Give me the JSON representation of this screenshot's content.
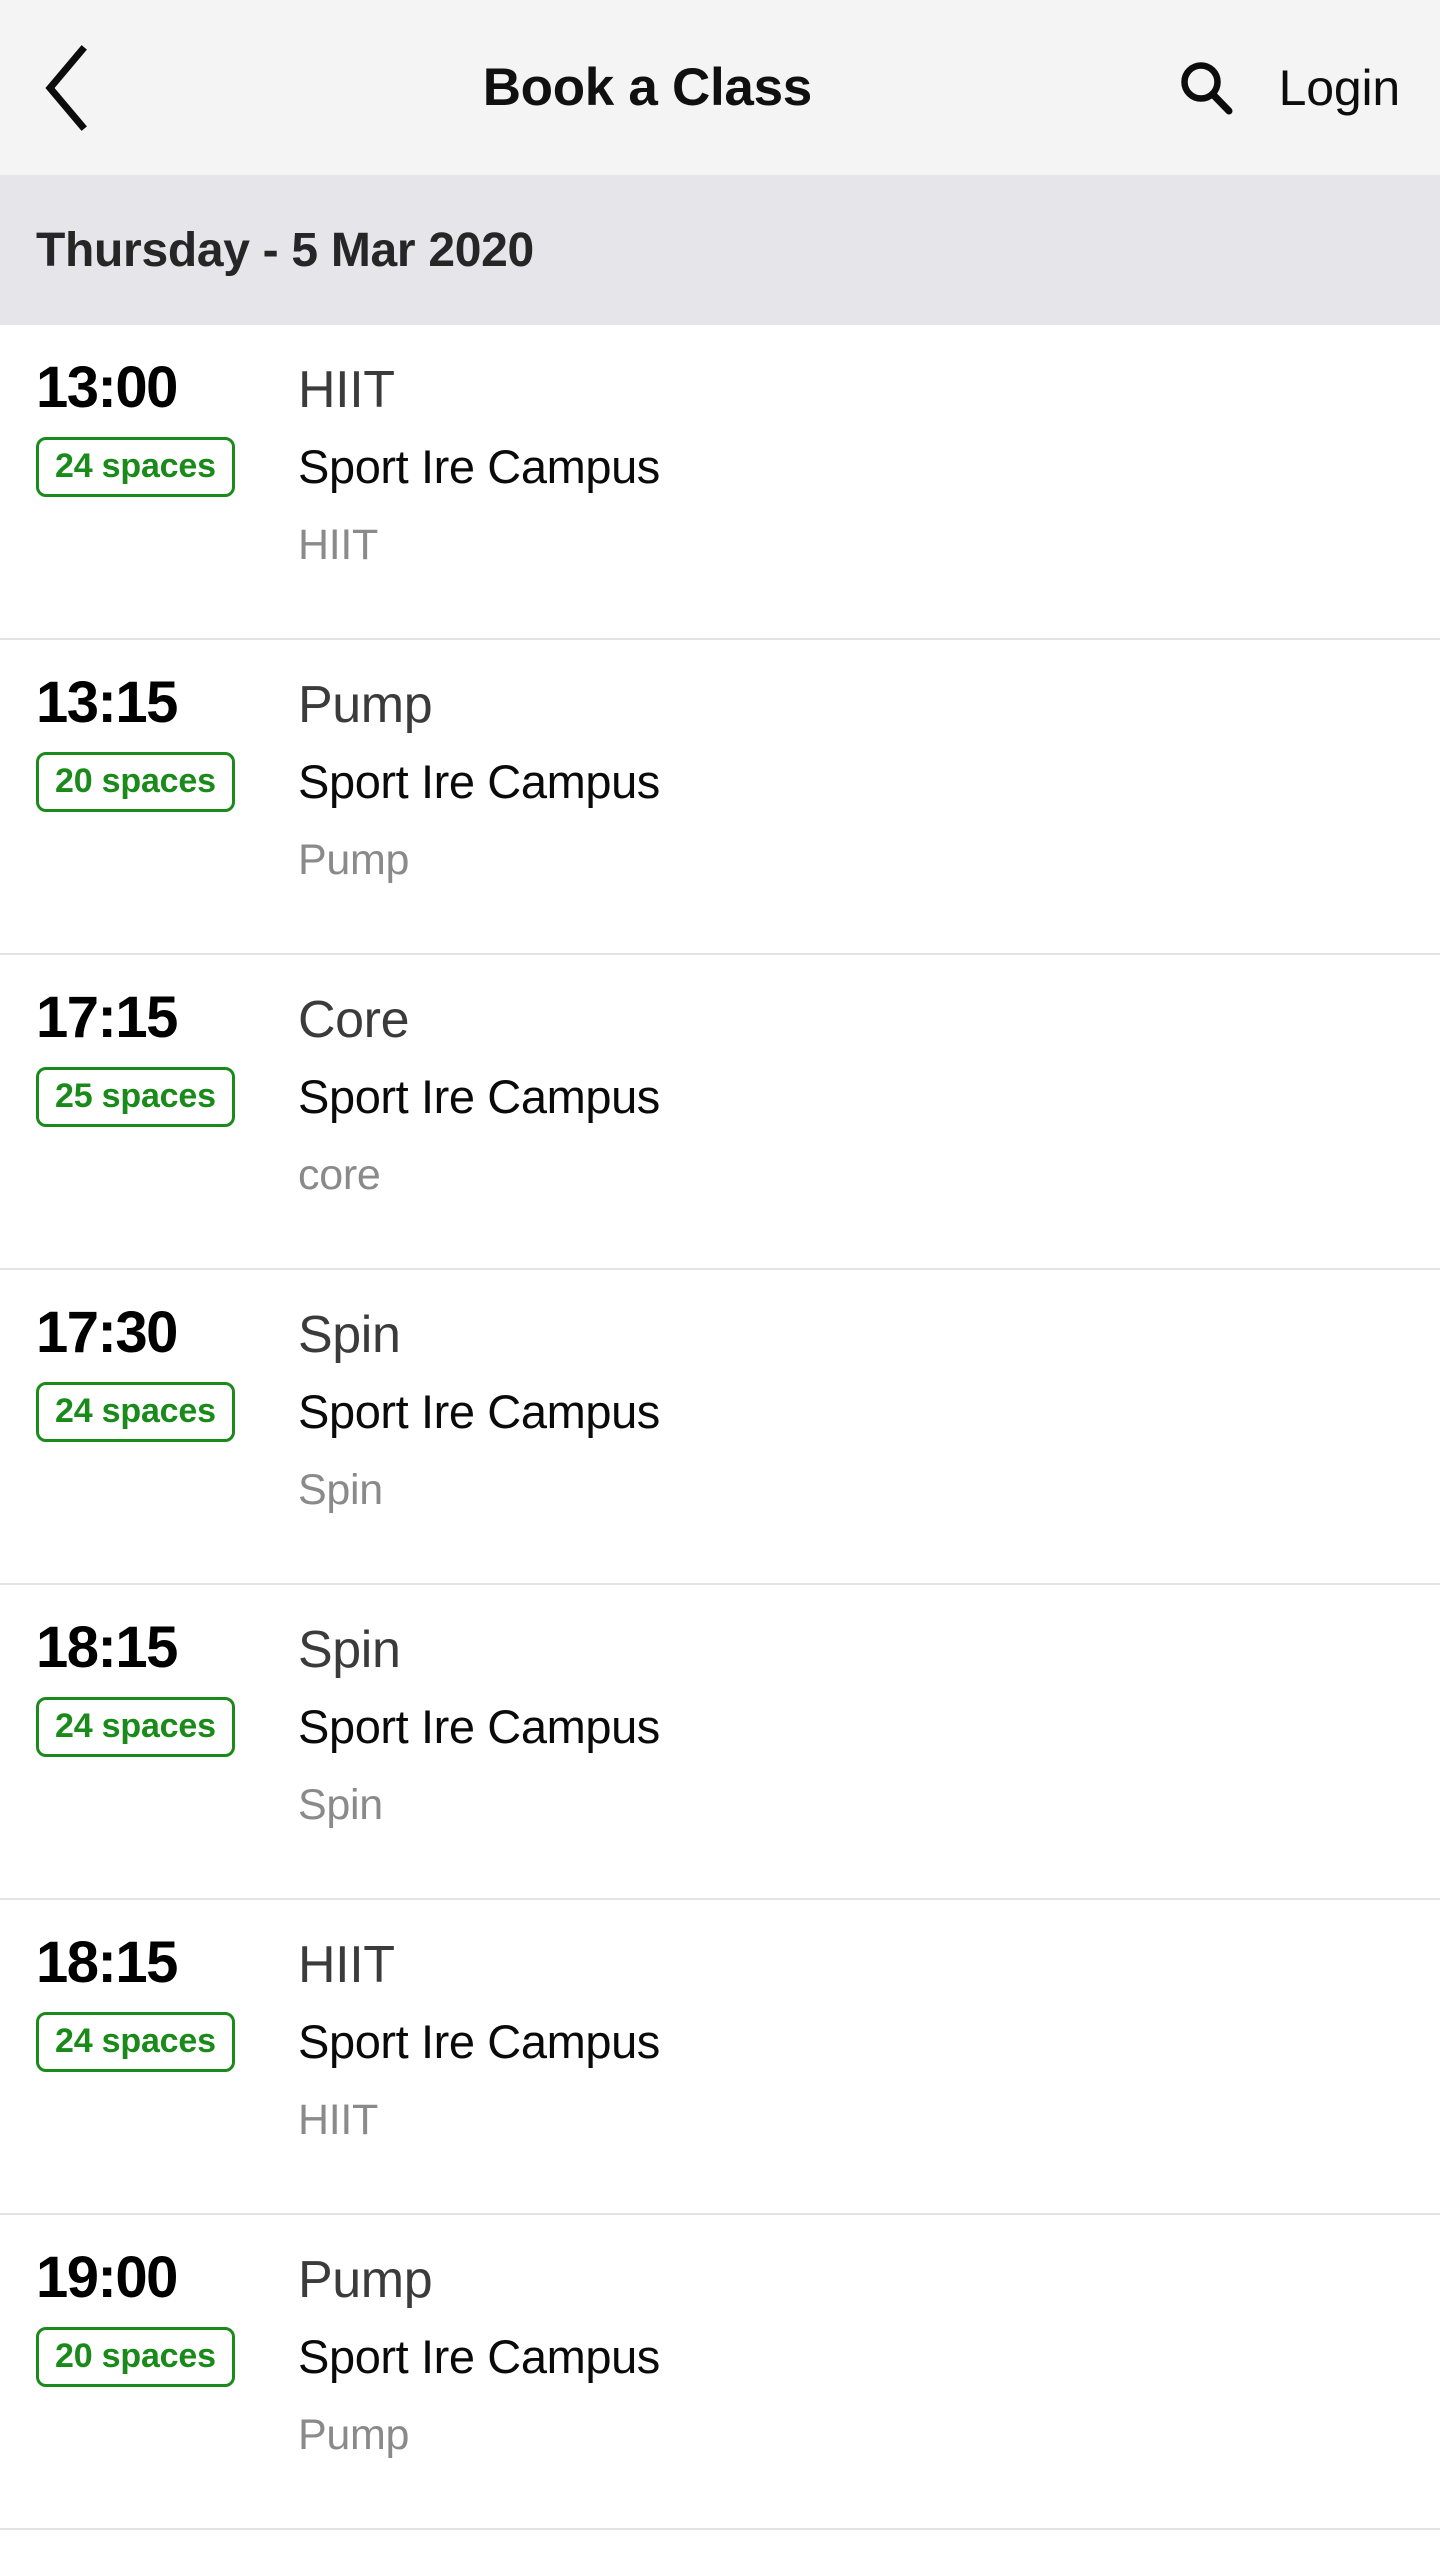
{
  "header": {
    "back_icon": "chevron-left-icon",
    "title": "Book a Class",
    "search_icon": "search-icon",
    "login_label": "Login"
  },
  "date_section": {
    "label": "Thursday - 5 Mar 2020"
  },
  "colors": {
    "navbar_background": "#f4f4f5",
    "date_band_background": "#e6e6ea",
    "badge_green": "#1a8b1a",
    "row_divider": "#e3e3e3",
    "time_text": "#000000",
    "class_name_text": "#3b3b3b",
    "location_text": "#0a0a0a",
    "description_text": "#8a8a8a"
  },
  "classes": [
    {
      "time": "13:00",
      "spaces": "24 spaces",
      "name": "HIIT",
      "location": "Sport Ire Campus",
      "description": "HIIT"
    },
    {
      "time": "13:15",
      "spaces": "20 spaces",
      "name": "Pump",
      "location": "Sport Ire Campus",
      "description": "Pump"
    },
    {
      "time": "17:15",
      "spaces": "25 spaces",
      "name": "Core",
      "location": "Sport Ire Campus",
      "description": "core"
    },
    {
      "time": "17:30",
      "spaces": "24 spaces",
      "name": "Spin",
      "location": "Sport Ire Campus",
      "description": "Spin"
    },
    {
      "time": "18:15",
      "spaces": "24 spaces",
      "name": "Spin",
      "location": "Sport Ire Campus",
      "description": "Spin"
    },
    {
      "time": "18:15",
      "spaces": "24 spaces",
      "name": "HIIT",
      "location": "Sport Ire Campus",
      "description": "HIIT"
    },
    {
      "time": "19:00",
      "spaces": "20 spaces",
      "name": "Pump",
      "location": "Sport Ire Campus",
      "description": "Pump"
    }
  ]
}
